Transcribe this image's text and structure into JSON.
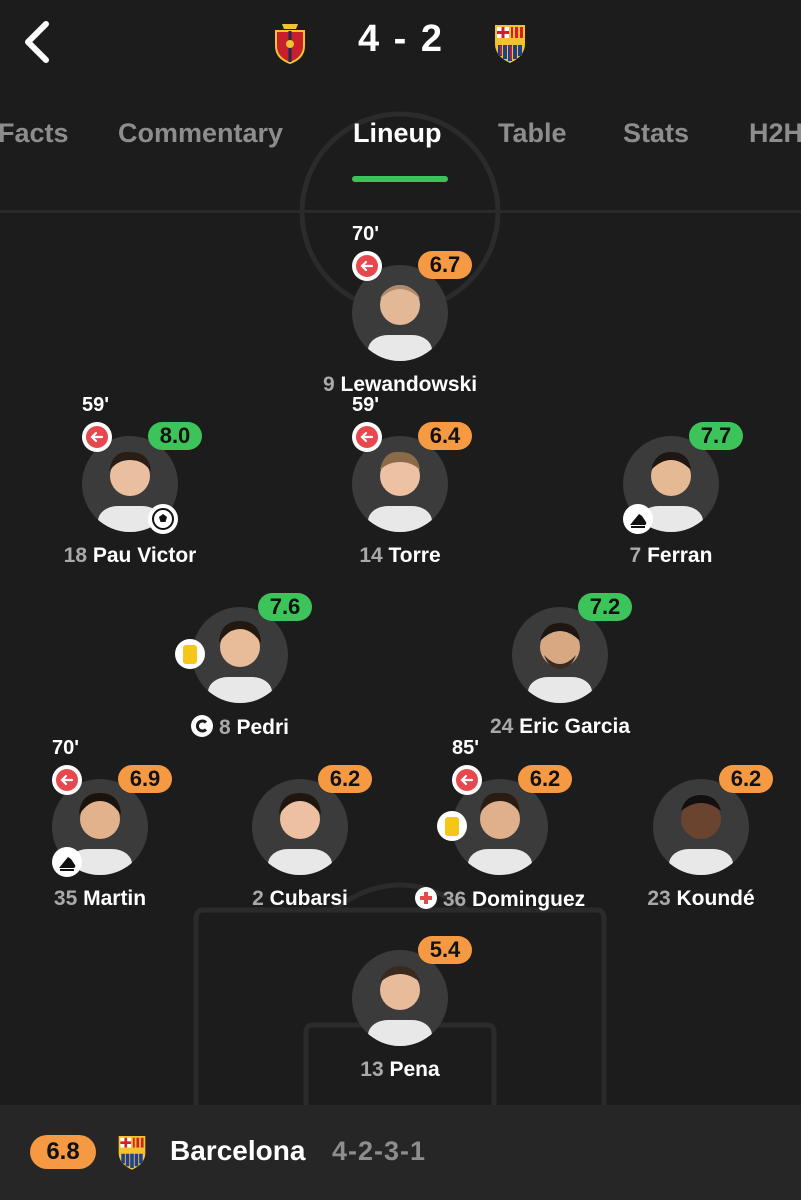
{
  "header": {
    "home_crest": "osasuna-crest-icon",
    "away_crest": "barcelona-crest-icon",
    "score": "4 - 2"
  },
  "tabs": [
    {
      "label": "Facts",
      "active": false
    },
    {
      "label": "Commentary",
      "active": false
    },
    {
      "label": "Lineup",
      "active": true
    },
    {
      "label": "Table",
      "active": false
    },
    {
      "label": "Stats",
      "active": false
    },
    {
      "label": "H2H",
      "active": false
    }
  ],
  "colors": {
    "accent_green": "#3cc45a",
    "rating_orange": "#f59a42",
    "sub_red": "#e5484d",
    "yellow_card": "#f5c518"
  },
  "players": {
    "lewandowski": {
      "number": "9",
      "name": "Lewandowski",
      "rating": "6.7",
      "sub_time": "70'"
    },
    "pau_victor": {
      "number": "18",
      "name": "Pau Victor",
      "rating": "8.0",
      "sub_time": "59'"
    },
    "torre": {
      "number": "14",
      "name": "Torre",
      "rating": "6.4",
      "sub_time": "59'"
    },
    "ferran": {
      "number": "7",
      "name": "Ferran",
      "rating": "7.7"
    },
    "pedri": {
      "number": "8",
      "name": "Pedri",
      "rating": "7.6"
    },
    "eric_garcia": {
      "number": "24",
      "name": "Eric Garcia",
      "rating": "7.2"
    },
    "martin": {
      "number": "35",
      "name": "Martin",
      "rating": "6.9",
      "sub_time": "70'"
    },
    "cubarsi": {
      "number": "2",
      "name": "Cubarsi",
      "rating": "6.2"
    },
    "dominguez": {
      "number": "36",
      "name": "Dominguez",
      "rating": "6.2",
      "sub_time": "85'"
    },
    "kounde": {
      "number": "23",
      "name": "Koundé",
      "rating": "6.2"
    },
    "pena": {
      "number": "13",
      "name": "Pena",
      "rating": "5.4"
    }
  },
  "footer": {
    "team_rating": "6.8",
    "team_name": "Barcelona",
    "formation": "4-2-3-1"
  }
}
